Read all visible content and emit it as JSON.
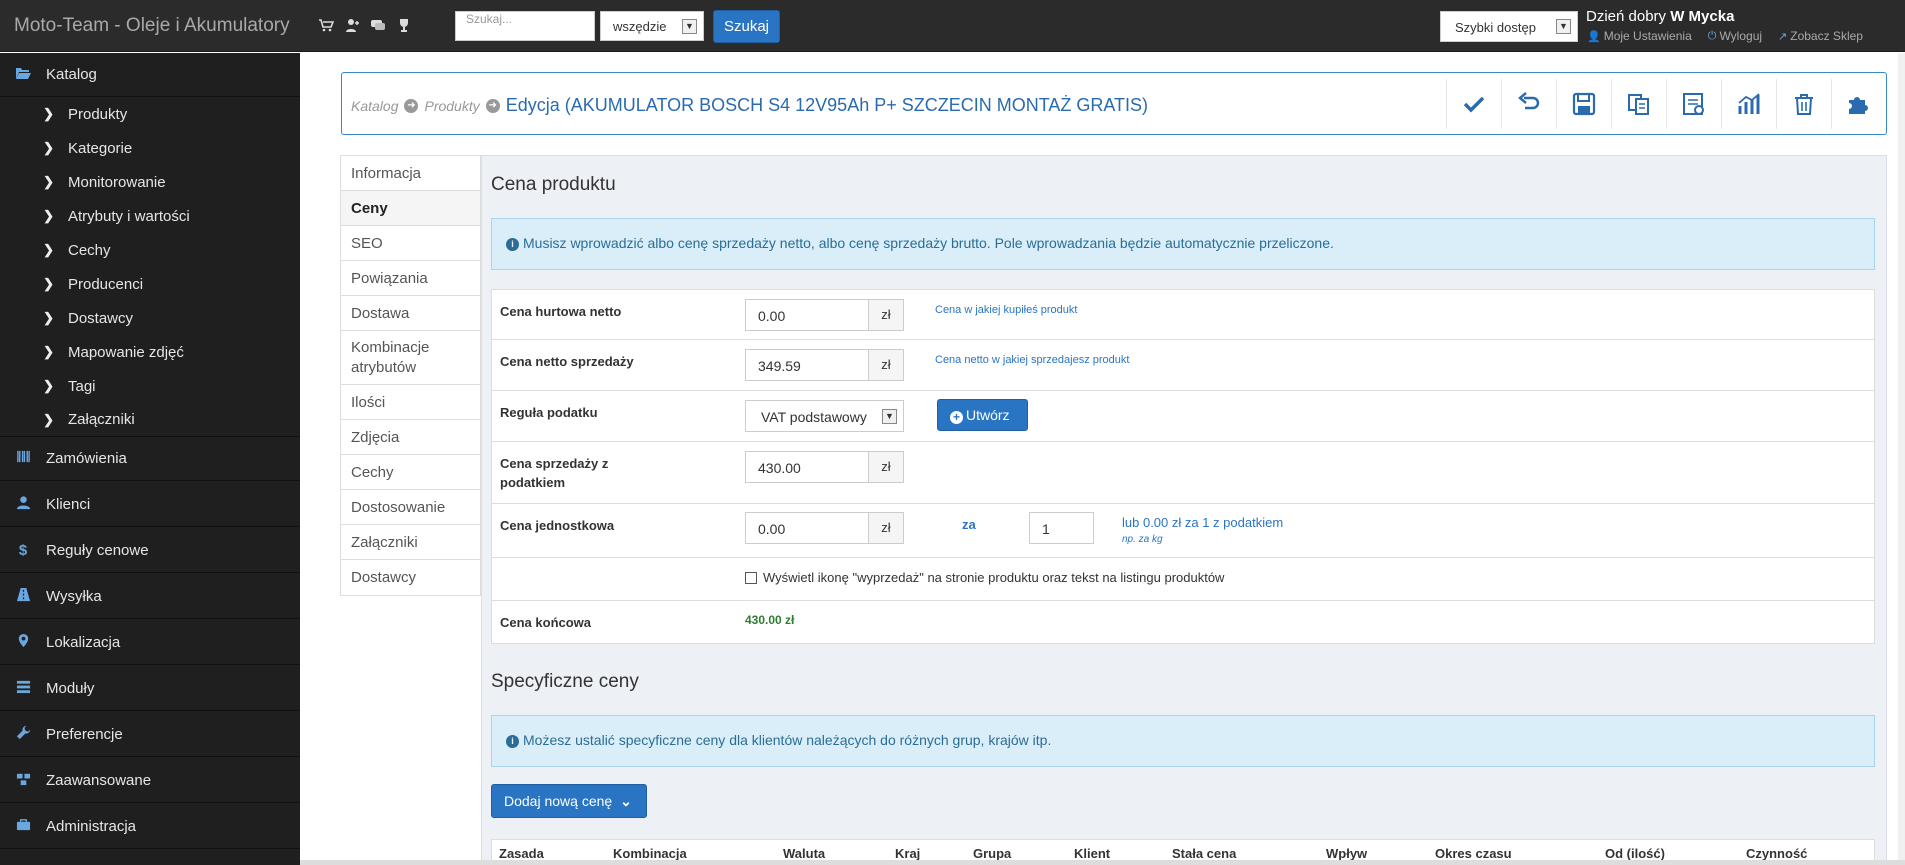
{
  "topbar": {
    "brand": "Moto-Team - Oleje i Akumulatory",
    "search_placeholder": "Szukaj...",
    "search_scope": "wszędzie",
    "search_button": "Szukaj",
    "quick_access": "Szybki dostęp",
    "greeting_prefix": "Dzień dobry",
    "greeting_name": "W Mycka",
    "links": {
      "settings": "Moje Ustawienia",
      "logout": "Wyloguj",
      "view_shop": "Zobacz Sklep"
    }
  },
  "sidebar": {
    "catalog": "Katalog",
    "catalog_items": [
      "Produkty",
      "Kategorie",
      "Monitorowanie",
      "Atrybuty i wartości",
      "Cechy",
      "Producenci",
      "Dostawcy",
      "Mapowanie zdjęć",
      "Tagi",
      "Załączniki"
    ],
    "menu": [
      "Zamówienia",
      "Klienci",
      "Reguły cenowe",
      "Wysyłka",
      "Lokalizacja",
      "Moduły",
      "Preferencje",
      "Zaawansowane",
      "Administracja"
    ]
  },
  "breadcrumb": {
    "level1": "Katalog",
    "level2": "Produkty",
    "current": "Edycja (AKUMULATOR BOSCH S4 12V95Ah P+ SZCZECIN MONTAŻ GRATIS)"
  },
  "tabs": [
    "Informacja",
    "Ceny",
    "SEO",
    "Powiązania",
    "Dostawa",
    "Kombinacje atrybutów",
    "Ilości",
    "Zdjęcia",
    "Cechy",
    "Dostosowanie",
    "Załączniki",
    "Dostawcy"
  ],
  "active_tab": "Ceny",
  "pricing": {
    "title": "Cena produktu",
    "alert": "Musisz wprowadzić albo cenę sprzedaży netto, albo cenę sprzedaży brutto. Pole wprowadzania będzie automatycznie przeliczone.",
    "currency": "zł",
    "wholesale_label": "Cena hurtowa netto",
    "wholesale_value": "0.00",
    "wholesale_help": "Cena w jakiej kupiłeś produkt",
    "net_label": "Cena netto sprzedaży",
    "net_value": "349.59",
    "net_help": "Cena netto w jakiej sprzedajesz produkt",
    "tax_label": "Reguła podatku",
    "tax_value": "VAT podstawowy",
    "create_button": "Utwórz",
    "gross_label": "Cena sprzedaży z podatkiem",
    "gross_value": "430.00",
    "unit_label": "Cena jednostkowa",
    "unit_value": "0.00",
    "unit_za": "za",
    "unit_qty": "1",
    "unit_help": "lub 0.00 zł za 1 z podatkiem",
    "unit_example": "np. za kg",
    "sale_checkbox_label": "Wyświetl ikonę \"wyprzedaż\" na stronie produktu oraz tekst na listingu produktów",
    "final_label": "Cena końcowa",
    "final_value": "430.00 zł"
  },
  "specific": {
    "title": "Specyficzne ceny",
    "alert": "Możesz ustalić specyficzne ceny dla klientów należących do różnych grup, krajów itp.",
    "add_button": "Dodaj nową cenę",
    "columns": [
      "Zasada",
      "Kombinacja",
      "Waluta",
      "Kraj",
      "Grupa",
      "Klient",
      "Stała cena",
      "Wpływ",
      "Okres czasu",
      "Od (ilość)",
      "Czynność"
    ]
  },
  "colors": {
    "accent": "#2a75c3",
    "sidebar_bg": "#1f1f1f",
    "alert_bg": "#d9eef9",
    "final_price": "#2e7d32"
  }
}
